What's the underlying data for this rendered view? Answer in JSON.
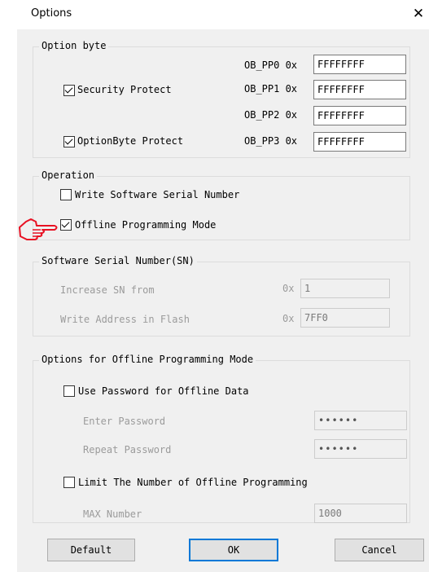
{
  "window": {
    "title": "Options",
    "close_glyph": "✕"
  },
  "option_byte": {
    "title": "Option byte",
    "security_protect": {
      "label": "Security Protect",
      "checked": true
    },
    "optionbyte_protect": {
      "label": "OptionByte Protect",
      "checked": true
    },
    "registers": [
      {
        "label": "OB_PP0 0x",
        "value": "FFFFFFFF"
      },
      {
        "label": "OB_PP1 0x",
        "value": "FFFFFFFF"
      },
      {
        "label": "OB_PP2 0x",
        "value": "FFFFFFFF"
      },
      {
        "label": "OB_PP3 0x",
        "value": "FFFFFFFF"
      }
    ]
  },
  "operation": {
    "title": "Operation",
    "write_sn": {
      "label": "Write Software Serial Number",
      "checked": false
    },
    "offline_mode": {
      "label": "Offline Programming Mode",
      "checked": true
    }
  },
  "pointer": {
    "icon": "pointing-hand-icon",
    "color": "#e81123"
  },
  "serial_number": {
    "title": "Software Serial Number(SN)",
    "increase_label": "Increase SN from",
    "increase_prefix": "0x",
    "increase_value": "1",
    "address_label": "Write Address in Flash",
    "address_prefix": "0x",
    "address_value": "7FF0"
  },
  "offline_options": {
    "title": "Options for Offline Programming Mode",
    "use_password": {
      "label": "Use Password for Offline Data",
      "checked": false
    },
    "enter_password_label": "Enter Password",
    "enter_password_value": "••••••",
    "repeat_password_label": "Repeat Password",
    "repeat_password_value": "••••••",
    "limit_number": {
      "label": "Limit The Number of Offline Programming",
      "checked": false
    },
    "max_label": "MAX Number",
    "max_value": "1000"
  },
  "buttons": {
    "default": "Default",
    "ok": "OK",
    "cancel": "Cancel"
  },
  "colors": {
    "dialog_bg": "#f0f0f0",
    "focus_border": "#0078d7",
    "disabled_text": "#9b9b9b"
  }
}
